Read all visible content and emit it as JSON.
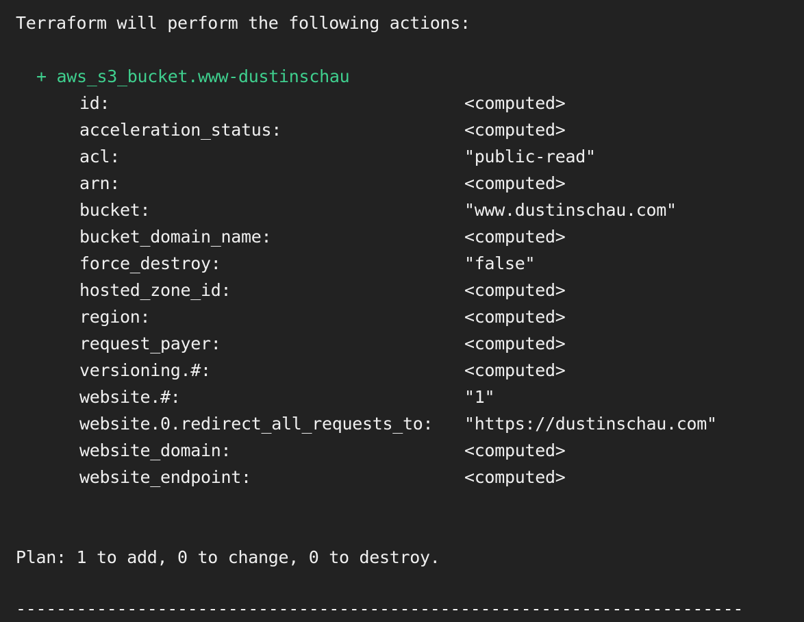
{
  "terminal": {
    "header": "Terraform will perform the following actions:",
    "resource": {
      "symbol": "+",
      "name": "aws_s3_bucket.www-dustinschau"
    },
    "attributes": [
      {
        "key": "id:",
        "value": "<computed>"
      },
      {
        "key": "acceleration_status:",
        "value": "<computed>"
      },
      {
        "key": "acl:",
        "value": "\"public-read\""
      },
      {
        "key": "arn:",
        "value": "<computed>"
      },
      {
        "key": "bucket:",
        "value": "\"www.dustinschau.com\""
      },
      {
        "key": "bucket_domain_name:",
        "value": "<computed>"
      },
      {
        "key": "force_destroy:",
        "value": "\"false\""
      },
      {
        "key": "hosted_zone_id:",
        "value": "<computed>"
      },
      {
        "key": "region:",
        "value": "<computed>"
      },
      {
        "key": "request_payer:",
        "value": "<computed>"
      },
      {
        "key": "versioning.#:",
        "value": "<computed>"
      },
      {
        "key": "website.#:",
        "value": "\"1\""
      },
      {
        "key": "website.0.redirect_all_requests_to:",
        "value": "\"https://dustinschau.com\""
      },
      {
        "key": "website_domain:",
        "value": "<computed>"
      },
      {
        "key": "website_endpoint:",
        "value": "<computed>"
      }
    ],
    "plan_summary": "Plan: 1 to add, 0 to change, 0 to destroy.",
    "separator": "------------------------------------------------------------------------"
  },
  "colors": {
    "background": "#222222",
    "text": "#f0f0f0",
    "add_green": "#3fcf8e"
  }
}
